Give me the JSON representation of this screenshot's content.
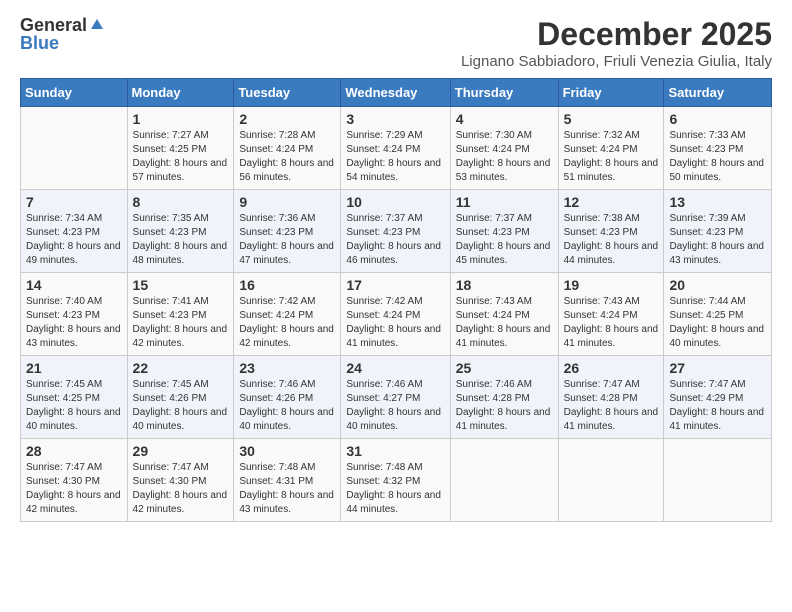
{
  "logo": {
    "general": "General",
    "blue": "Blue"
  },
  "title": "December 2025",
  "location": "Lignano Sabbiadoro, Friuli Venezia Giulia, Italy",
  "days_of_week": [
    "Sunday",
    "Monday",
    "Tuesday",
    "Wednesday",
    "Thursday",
    "Friday",
    "Saturday"
  ],
  "weeks": [
    [
      {
        "day": "",
        "sunrise": "",
        "sunset": "",
        "daylight": ""
      },
      {
        "day": "1",
        "sunrise": "Sunrise: 7:27 AM",
        "sunset": "Sunset: 4:25 PM",
        "daylight": "Daylight: 8 hours and 57 minutes."
      },
      {
        "day": "2",
        "sunrise": "Sunrise: 7:28 AM",
        "sunset": "Sunset: 4:24 PM",
        "daylight": "Daylight: 8 hours and 56 minutes."
      },
      {
        "day": "3",
        "sunrise": "Sunrise: 7:29 AM",
        "sunset": "Sunset: 4:24 PM",
        "daylight": "Daylight: 8 hours and 54 minutes."
      },
      {
        "day": "4",
        "sunrise": "Sunrise: 7:30 AM",
        "sunset": "Sunset: 4:24 PM",
        "daylight": "Daylight: 8 hours and 53 minutes."
      },
      {
        "day": "5",
        "sunrise": "Sunrise: 7:32 AM",
        "sunset": "Sunset: 4:24 PM",
        "daylight": "Daylight: 8 hours and 51 minutes."
      },
      {
        "day": "6",
        "sunrise": "Sunrise: 7:33 AM",
        "sunset": "Sunset: 4:23 PM",
        "daylight": "Daylight: 8 hours and 50 minutes."
      }
    ],
    [
      {
        "day": "7",
        "sunrise": "Sunrise: 7:34 AM",
        "sunset": "Sunset: 4:23 PM",
        "daylight": "Daylight: 8 hours and 49 minutes."
      },
      {
        "day": "8",
        "sunrise": "Sunrise: 7:35 AM",
        "sunset": "Sunset: 4:23 PM",
        "daylight": "Daylight: 8 hours and 48 minutes."
      },
      {
        "day": "9",
        "sunrise": "Sunrise: 7:36 AM",
        "sunset": "Sunset: 4:23 PM",
        "daylight": "Daylight: 8 hours and 47 minutes."
      },
      {
        "day": "10",
        "sunrise": "Sunrise: 7:37 AM",
        "sunset": "Sunset: 4:23 PM",
        "daylight": "Daylight: 8 hours and 46 minutes."
      },
      {
        "day": "11",
        "sunrise": "Sunrise: 7:37 AM",
        "sunset": "Sunset: 4:23 PM",
        "daylight": "Daylight: 8 hours and 45 minutes."
      },
      {
        "day": "12",
        "sunrise": "Sunrise: 7:38 AM",
        "sunset": "Sunset: 4:23 PM",
        "daylight": "Daylight: 8 hours and 44 minutes."
      },
      {
        "day": "13",
        "sunrise": "Sunrise: 7:39 AM",
        "sunset": "Sunset: 4:23 PM",
        "daylight": "Daylight: 8 hours and 43 minutes."
      }
    ],
    [
      {
        "day": "14",
        "sunrise": "Sunrise: 7:40 AM",
        "sunset": "Sunset: 4:23 PM",
        "daylight": "Daylight: 8 hours and 43 minutes."
      },
      {
        "day": "15",
        "sunrise": "Sunrise: 7:41 AM",
        "sunset": "Sunset: 4:23 PM",
        "daylight": "Daylight: 8 hours and 42 minutes."
      },
      {
        "day": "16",
        "sunrise": "Sunrise: 7:42 AM",
        "sunset": "Sunset: 4:24 PM",
        "daylight": "Daylight: 8 hours and 42 minutes."
      },
      {
        "day": "17",
        "sunrise": "Sunrise: 7:42 AM",
        "sunset": "Sunset: 4:24 PM",
        "daylight": "Daylight: 8 hours and 41 minutes."
      },
      {
        "day": "18",
        "sunrise": "Sunrise: 7:43 AM",
        "sunset": "Sunset: 4:24 PM",
        "daylight": "Daylight: 8 hours and 41 minutes."
      },
      {
        "day": "19",
        "sunrise": "Sunrise: 7:43 AM",
        "sunset": "Sunset: 4:24 PM",
        "daylight": "Daylight: 8 hours and 41 minutes."
      },
      {
        "day": "20",
        "sunrise": "Sunrise: 7:44 AM",
        "sunset": "Sunset: 4:25 PM",
        "daylight": "Daylight: 8 hours and 40 minutes."
      }
    ],
    [
      {
        "day": "21",
        "sunrise": "Sunrise: 7:45 AM",
        "sunset": "Sunset: 4:25 PM",
        "daylight": "Daylight: 8 hours and 40 minutes."
      },
      {
        "day": "22",
        "sunrise": "Sunrise: 7:45 AM",
        "sunset": "Sunset: 4:26 PM",
        "daylight": "Daylight: 8 hours and 40 minutes."
      },
      {
        "day": "23",
        "sunrise": "Sunrise: 7:46 AM",
        "sunset": "Sunset: 4:26 PM",
        "daylight": "Daylight: 8 hours and 40 minutes."
      },
      {
        "day": "24",
        "sunrise": "Sunrise: 7:46 AM",
        "sunset": "Sunset: 4:27 PM",
        "daylight": "Daylight: 8 hours and 40 minutes."
      },
      {
        "day": "25",
        "sunrise": "Sunrise: 7:46 AM",
        "sunset": "Sunset: 4:28 PM",
        "daylight": "Daylight: 8 hours and 41 minutes."
      },
      {
        "day": "26",
        "sunrise": "Sunrise: 7:47 AM",
        "sunset": "Sunset: 4:28 PM",
        "daylight": "Daylight: 8 hours and 41 minutes."
      },
      {
        "day": "27",
        "sunrise": "Sunrise: 7:47 AM",
        "sunset": "Sunset: 4:29 PM",
        "daylight": "Daylight: 8 hours and 41 minutes."
      }
    ],
    [
      {
        "day": "28",
        "sunrise": "Sunrise: 7:47 AM",
        "sunset": "Sunset: 4:30 PM",
        "daylight": "Daylight: 8 hours and 42 minutes."
      },
      {
        "day": "29",
        "sunrise": "Sunrise: 7:47 AM",
        "sunset": "Sunset: 4:30 PM",
        "daylight": "Daylight: 8 hours and 42 minutes."
      },
      {
        "day": "30",
        "sunrise": "Sunrise: 7:48 AM",
        "sunset": "Sunset: 4:31 PM",
        "daylight": "Daylight: 8 hours and 43 minutes."
      },
      {
        "day": "31",
        "sunrise": "Sunrise: 7:48 AM",
        "sunset": "Sunset: 4:32 PM",
        "daylight": "Daylight: 8 hours and 44 minutes."
      },
      {
        "day": "",
        "sunrise": "",
        "sunset": "",
        "daylight": ""
      },
      {
        "day": "",
        "sunrise": "",
        "sunset": "",
        "daylight": ""
      },
      {
        "day": "",
        "sunrise": "",
        "sunset": "",
        "daylight": ""
      }
    ]
  ]
}
